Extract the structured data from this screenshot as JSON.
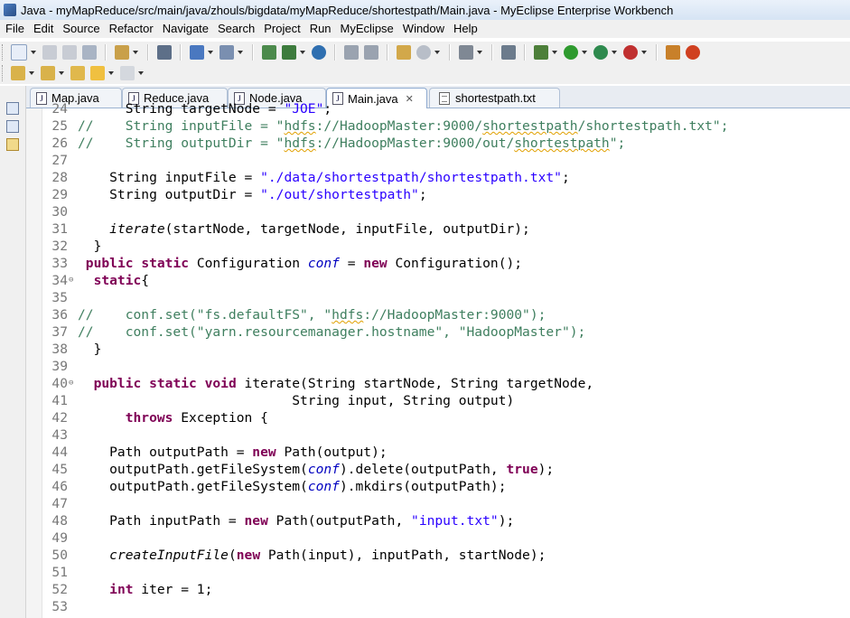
{
  "window": {
    "title": "Java - myMapReduce/src/main/java/zhouls/bigdata/myMapReduce/shortestpath/Main.java - MyEclipse Enterprise Workbench"
  },
  "menu": [
    "File",
    "Edit",
    "Source",
    "Refactor",
    "Navigate",
    "Search",
    "Project",
    "Run",
    "MyEclipse",
    "Window",
    "Help"
  ],
  "tabs": [
    {
      "label": "Map.java",
      "icon": "java-file-icon",
      "active": false
    },
    {
      "label": "Reduce.java",
      "icon": "java-file-icon",
      "active": false
    },
    {
      "label": "Node.java",
      "icon": "java-file-icon",
      "active": false
    },
    {
      "label": "Main.java",
      "icon": "java-file-icon",
      "active": true,
      "close": "✕"
    },
    {
      "label": "shortestpath.txt",
      "icon": "text-file-icon",
      "active": false
    }
  ],
  "code": {
    "lines": [
      {
        "n": "24",
        "text": "      String targetNode = \"JOE\";"
      },
      {
        "n": "25",
        "text": "//    String inputFile = \"hdfs://HadoopMaster:9000/shortestpath/shortestpath.txt\";"
      },
      {
        "n": "26",
        "text": "//    String outputDir = \"hdfs://HadoopMaster:9000/out/shortestpath\";"
      },
      {
        "n": "27",
        "text": ""
      },
      {
        "n": "28",
        "text": "      String inputFile = \"./data/shortestpath/shortestpath.txt\";"
      },
      {
        "n": "29",
        "text": "      String outputDir = \"./out/shortestpath\";"
      },
      {
        "n": "30",
        "text": ""
      },
      {
        "n": "31",
        "text": "      iterate(startNode, targetNode, inputFile, outputDir);"
      },
      {
        "n": "32",
        "text": "  }"
      },
      {
        "n": "33",
        "text": " public static Configuration conf = new Configuration();"
      },
      {
        "n": "34",
        "text": "  static{"
      },
      {
        "n": "35",
        "text": ""
      },
      {
        "n": "36",
        "text": "//    conf.set(\"fs.defaultFS\", \"hdfs://HadoopMaster:9000\");"
      },
      {
        "n": "37",
        "text": "//    conf.set(\"yarn.resourcemanager.hostname\", \"HadoopMaster\");"
      },
      {
        "n": "38",
        "text": "  }"
      },
      {
        "n": "39",
        "text": ""
      },
      {
        "n": "40",
        "text": "  public static void iterate(String startNode, String targetNode,"
      },
      {
        "n": "41",
        "text": "                           String input, String output)"
      },
      {
        "n": "42",
        "text": "      throws Exception {"
      },
      {
        "n": "43",
        "text": ""
      },
      {
        "n": "44",
        "text": "      Path outputPath = new Path(output);"
      },
      {
        "n": "45",
        "text": "      outputPath.getFileSystem(conf).delete(outputPath, true);"
      },
      {
        "n": "46",
        "text": "      outputPath.getFileSystem(conf).mkdirs(outputPath);"
      },
      {
        "n": "47",
        "text": ""
      },
      {
        "n": "48",
        "text": "      Path inputPath = new Path(outputPath, \"input.txt\");"
      },
      {
        "n": "49",
        "text": ""
      },
      {
        "n": "50",
        "text": "      createInputFile(new Path(input), inputPath, startNode);"
      },
      {
        "n": "51",
        "text": ""
      },
      {
        "n": "52",
        "text": "      int iter = 1;"
      },
      {
        "n": "53",
        "text": ""
      }
    ]
  }
}
